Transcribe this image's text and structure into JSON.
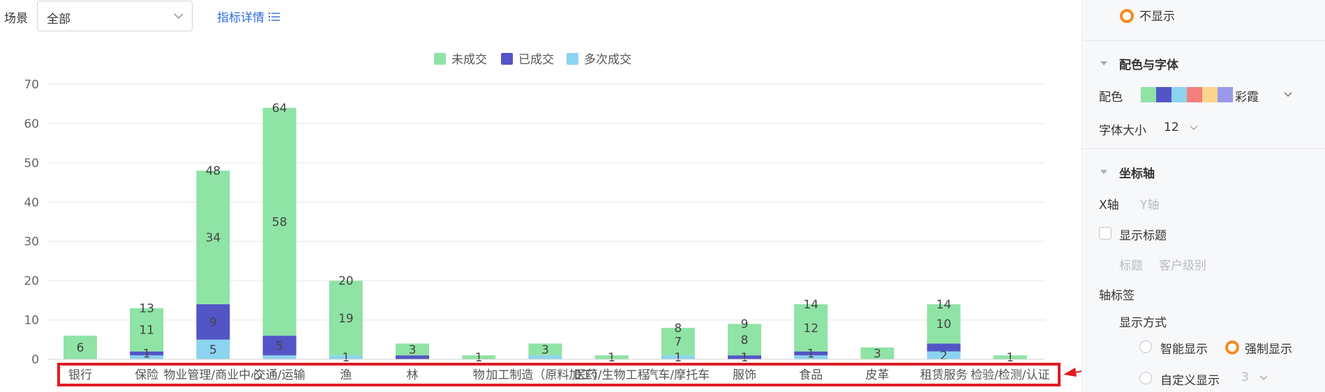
{
  "filter": {
    "label": "场景",
    "value": "全部",
    "detail_link": "指标详情"
  },
  "chart_data": {
    "type": "bar",
    "stacked": true,
    "legend_position": "top",
    "categories": [
      "银行",
      "保险",
      "物业管理/商业中心",
      "交通/运输",
      "渔",
      "林",
      "物",
      "加工制造（原料加工）",
      "医药/生物工程",
      "汽车/摩托车",
      "服饰",
      "食品",
      "皮革",
      "租赁服务",
      "检验/检测/认证"
    ],
    "series": [
      {
        "name": "未成交",
        "color": "#8fe3a5",
        "values": [
          6,
          11,
          34,
          58,
          19,
          3,
          1,
          3,
          1,
          7,
          8,
          12,
          3,
          10,
          1
        ]
      },
      {
        "name": "已成交",
        "color": "#5355c6",
        "values": [
          0,
          1,
          9,
          5,
          0,
          1,
          0,
          0,
          0,
          0,
          1,
          1,
          0,
          2,
          0
        ]
      },
      {
        "name": "多次成交",
        "color": "#8cd3ef",
        "values": [
          0,
          1,
          5,
          1,
          1,
          0,
          0,
          1,
          0,
          1,
          0,
          1,
          0,
          2,
          0
        ]
      }
    ],
    "totals": [
      6,
      13,
      48,
      64,
      20,
      4,
      1,
      4,
      1,
      8,
      9,
      14,
      3,
      14,
      1
    ],
    "segment_labels": [
      [
        "6",
        "",
        "",
        ""
      ],
      [
        "11",
        "1",
        "",
        "13"
      ],
      [
        "34",
        "9",
        "5",
        "48"
      ],
      [
        "58",
        "5",
        "",
        "64"
      ],
      [
        "19",
        "",
        "1",
        "20"
      ],
      [
        "3",
        "",
        "",
        ""
      ],
      [
        "1",
        "",
        "",
        ""
      ],
      [
        "3",
        "",
        "",
        ""
      ],
      [
        "1",
        "",
        "",
        ""
      ],
      [
        "7",
        "",
        "1",
        "8"
      ],
      [
        "8",
        "1",
        "",
        "9"
      ],
      [
        "12",
        "1",
        "",
        "14"
      ],
      [
        "3",
        "",
        "",
        ""
      ],
      [
        "10",
        "",
        "2",
        "14"
      ],
      [
        "1",
        "",
        "",
        ""
      ]
    ],
    "yticks": [
      0,
      10,
      20,
      30,
      40,
      50,
      60,
      70
    ],
    "ylim": [
      0,
      70
    ],
    "grid": true
  },
  "panel": {
    "hide_option": "不显示",
    "color_font_title": "配色与字体",
    "palette_label": "配色",
    "palette_name": "彩霞",
    "palette_colors": [
      "#8fe3a5",
      "#5355c6",
      "#8cd3ef",
      "#f47e7e",
      "#fbd58a",
      "#9a99ea"
    ],
    "font_size_label": "字体大小",
    "font_size_value": "12",
    "axis_title": "坐标轴",
    "x_axis_tab": "X轴",
    "y_axis_tab": "Y轴",
    "show_title_label": "显示标题",
    "title_label": "标题",
    "title_value": "客户级别",
    "axis_label_title": "轴标签",
    "display_mode_label": "显示方式",
    "smart_display": "智能显示",
    "force_display": "强制显示",
    "custom_display": "自定义显示",
    "custom_value": "3"
  }
}
